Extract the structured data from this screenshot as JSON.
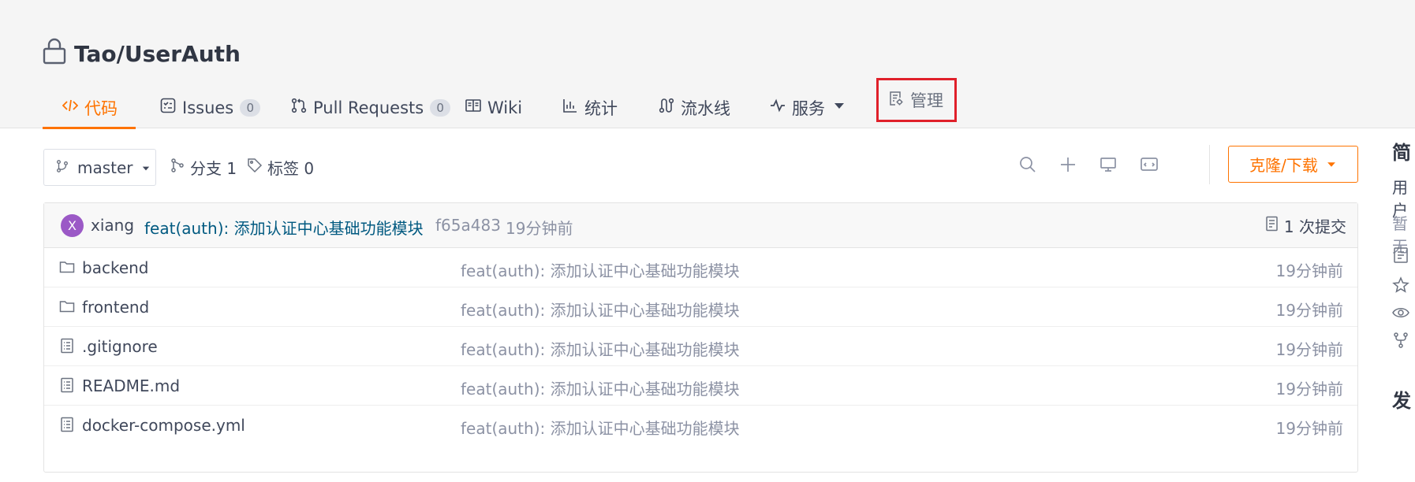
{
  "repo": {
    "title": "Tao/UserAuth"
  },
  "tabs": [
    {
      "label": "代码"
    },
    {
      "label": "Issues",
      "count": "0"
    },
    {
      "label": "Pull Requests",
      "count": "0"
    },
    {
      "label": "Wiki"
    },
    {
      "label": "统计"
    },
    {
      "label": "流水线"
    },
    {
      "label": "服务"
    },
    {
      "label": "管理"
    }
  ],
  "toolbar": {
    "branch": "master",
    "branches": "分支 1",
    "tags": "标签 0",
    "clone_label": "克隆/下载"
  },
  "commit": {
    "avatar_letter": "X",
    "author": "xiang",
    "message": "feat(auth): 添加认证中心基础功能模块",
    "hash": "f65a483",
    "time": "19分钟前",
    "count_label": "1 次提交"
  },
  "files": [
    {
      "name": "backend",
      "type": "folder",
      "message": "feat(auth): 添加认证中心基础功能模块",
      "time": "19分钟前"
    },
    {
      "name": "frontend",
      "type": "folder",
      "message": "feat(auth): 添加认证中心基础功能模块",
      "time": "19分钟前"
    },
    {
      "name": ".gitignore",
      "type": "file",
      "message": "feat(auth): 添加认证中心基础功能模块",
      "time": "19分钟前"
    },
    {
      "name": "README.md",
      "type": "file",
      "message": "feat(auth): 添加认证中心基础功能模块",
      "time": "19分钟前"
    },
    {
      "name": "docker-compose.yml",
      "type": "file",
      "message": "feat(auth): 添加认证中心基础功能模块",
      "time": "19分钟前"
    }
  ],
  "sidebar": {
    "title": "简",
    "line1": "用户",
    "line2": "暂无",
    "release_title": "发"
  },
  "colors": {
    "accent": "#fe7300",
    "highlight_box": "#e0202a",
    "commit_link": "#005980"
  }
}
